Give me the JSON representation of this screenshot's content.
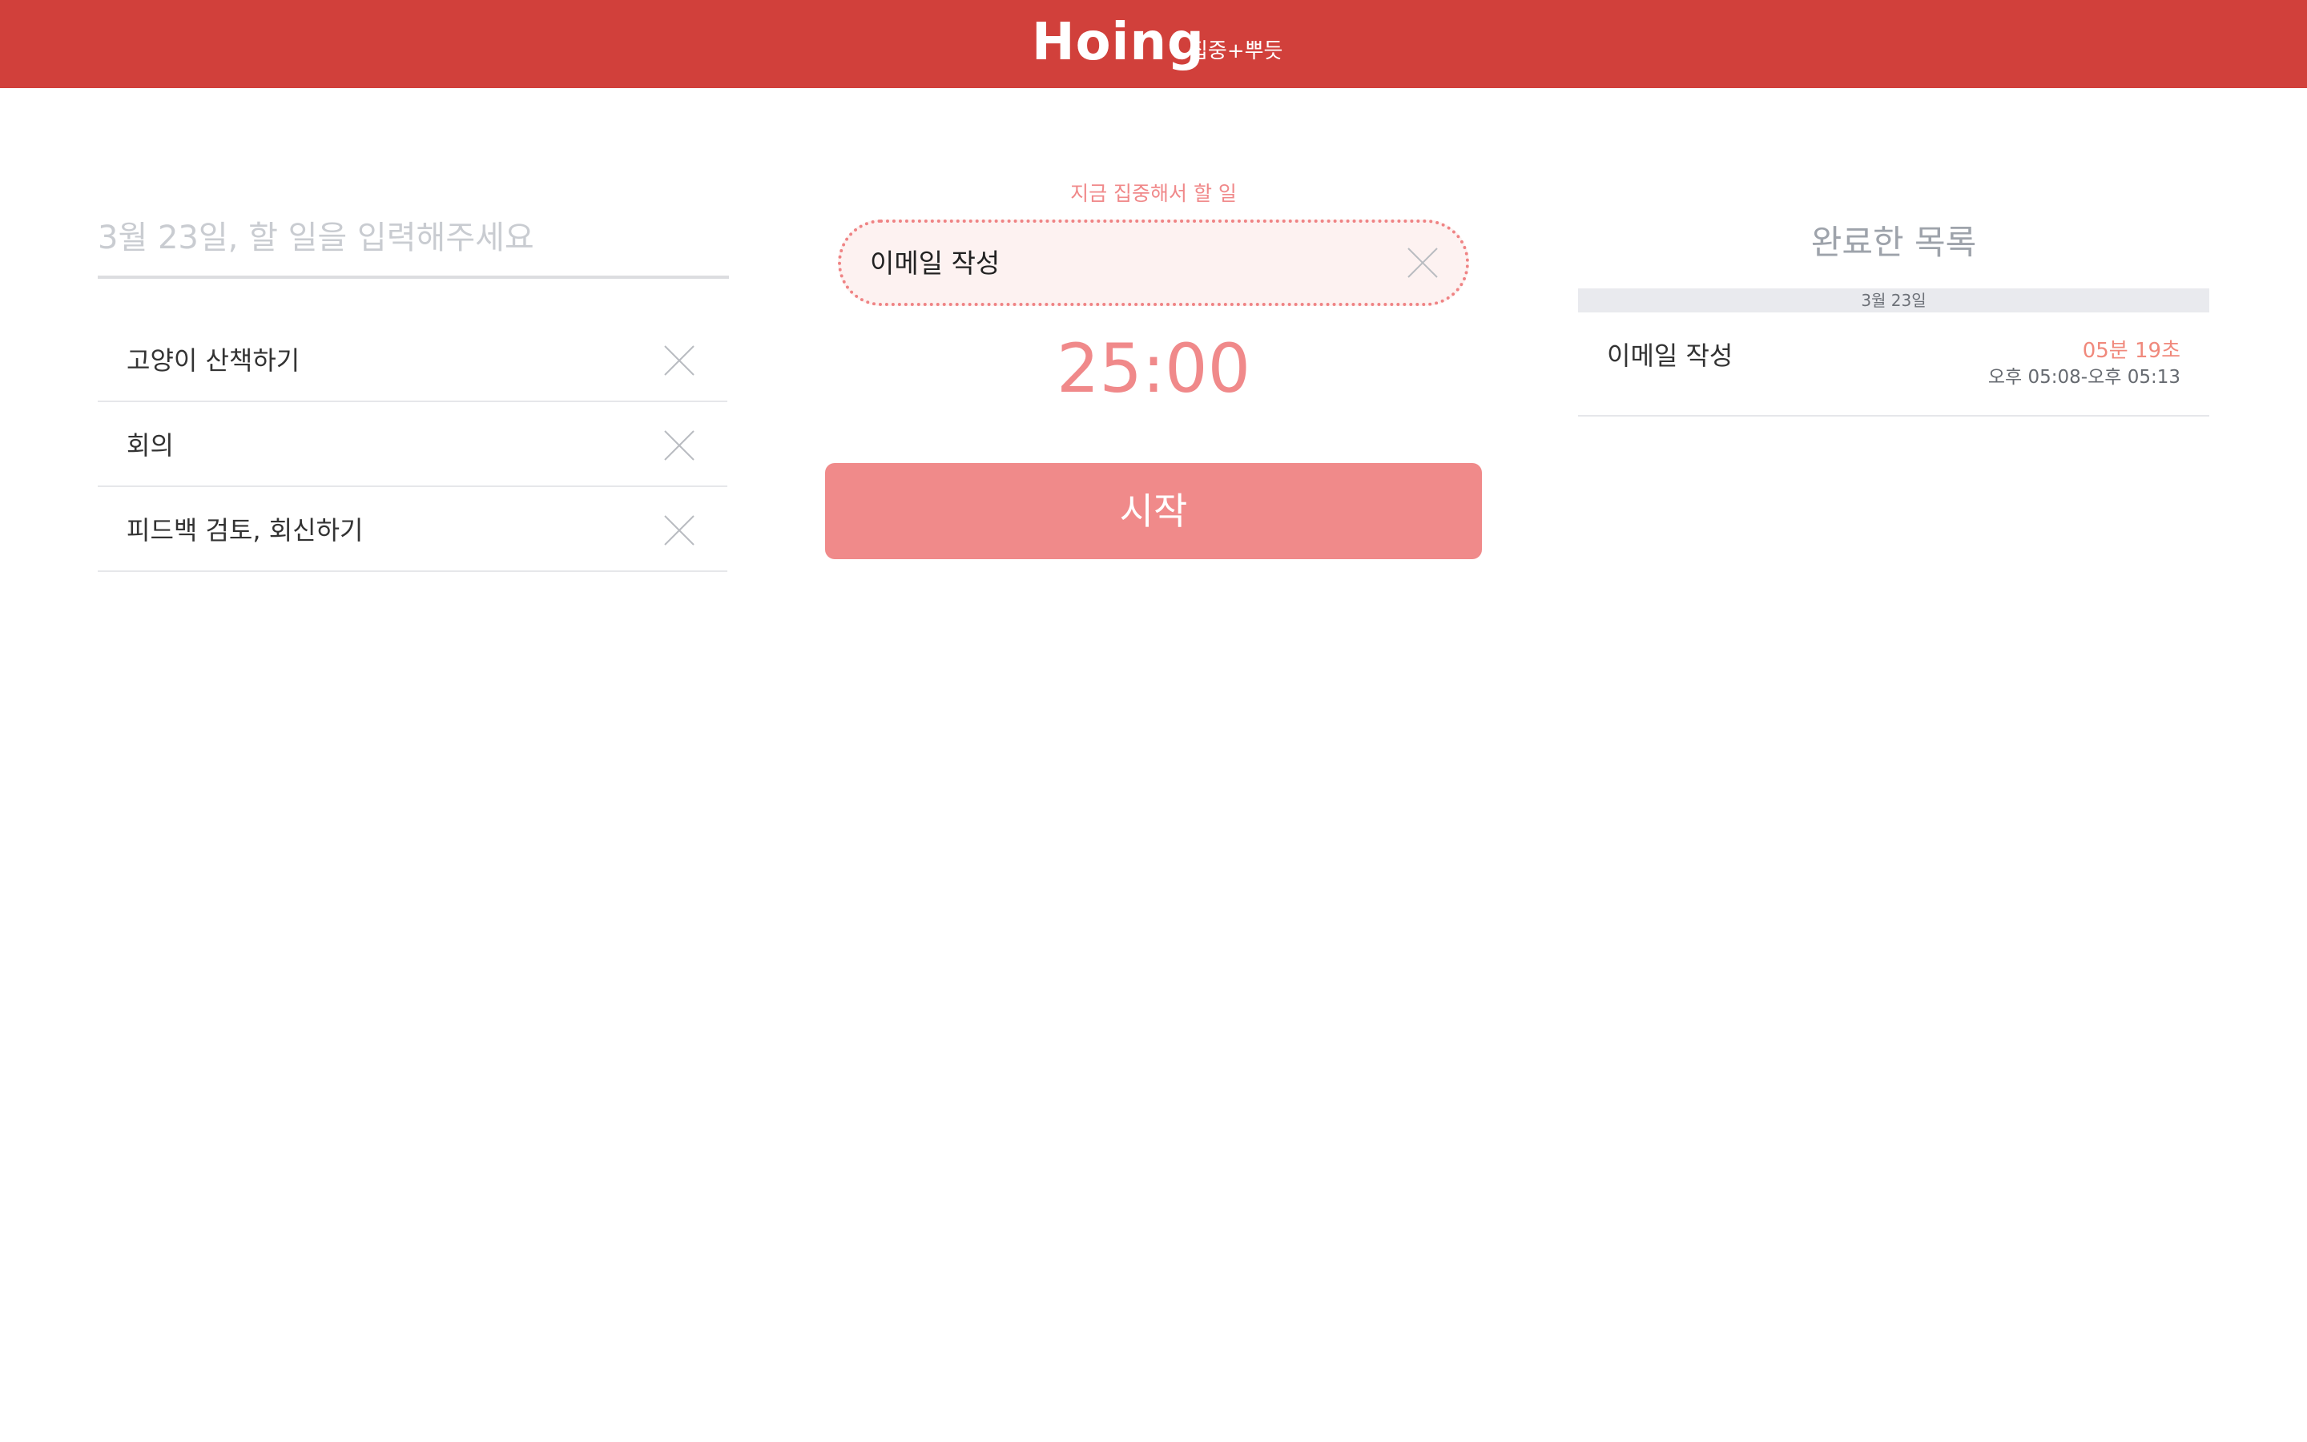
{
  "header": {
    "logo": "Hoing",
    "tagline": "집중+뿌듯",
    "background_color": "#d1403b"
  },
  "todo": {
    "input_placeholder": "3월 23일, 할 일을 입력해주세요",
    "input_value": "",
    "items": [
      {
        "label": "고양이 산책하기",
        "delete_icon": "close-icon"
      },
      {
        "label": "회의",
        "delete_icon": "close-icon"
      },
      {
        "label": "피드백 검토, 회신하기",
        "delete_icon": "close-icon"
      }
    ]
  },
  "focus": {
    "caption": "지금 집중해서 할 일",
    "current_task": "이메일 작성",
    "clear_icon": "close-icon",
    "timer": "25:00",
    "start_label": "시작",
    "accent_color": "#f08a8a"
  },
  "completed": {
    "title": "완료한 목록",
    "date": "3월 23일",
    "items": [
      {
        "label": "이메일 작성",
        "duration": "05분 19초",
        "time_range": "오후 05:08-오후 05:13"
      }
    ]
  }
}
